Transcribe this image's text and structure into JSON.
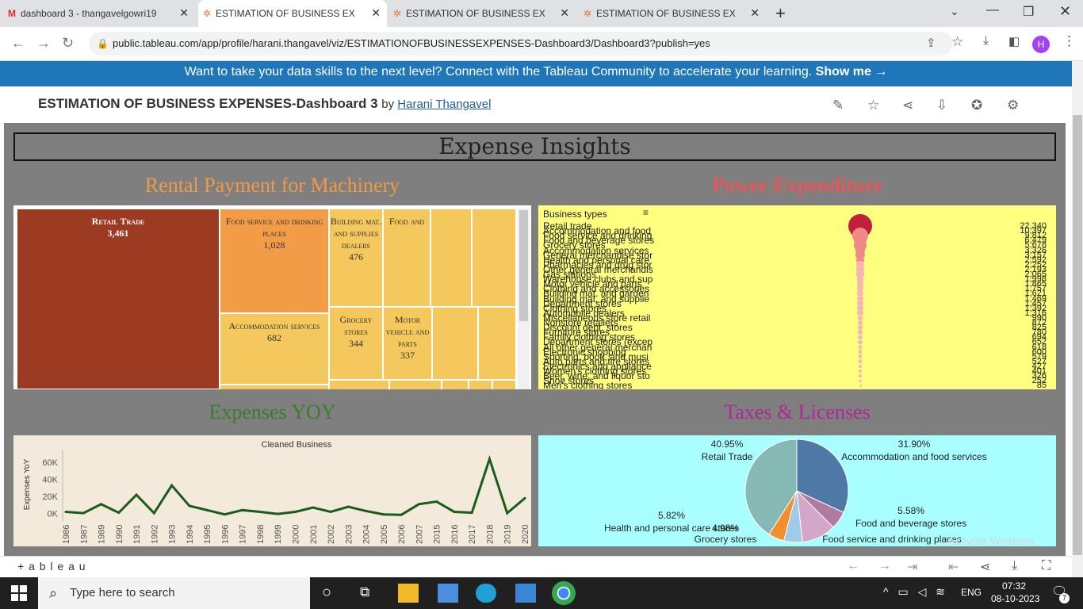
{
  "browser": {
    "tabs": [
      {
        "title": "dashboard 3 - thangavelgowri19",
        "icon": "gmail-icon"
      },
      {
        "title": "ESTIMATION OF BUSINESS EXPE",
        "icon": "tableau-icon",
        "active": true
      },
      {
        "title": "ESTIMATION OF BUSINESS EXPE",
        "icon": "tableau-icon"
      },
      {
        "title": "ESTIMATION OF BUSINESS EXPE",
        "icon": "tableau-icon"
      }
    ],
    "url": "public.tableau.com/app/profile/harani.thangavel/viz/ESTIMATIONOFBUSINESSEXPENSES-Dashboard3/Dashboard3?publish=yes",
    "profile_initial": "H"
  },
  "banner": {
    "text": "Want to take your data skills to the next level? Connect with the Tableau Community to accelerate your learning.",
    "link": "Show me →"
  },
  "viz": {
    "title": "ESTIMATION OF BUSINESS EXPENSES-Dashboard 3",
    "by": "by",
    "author": "Harani Thangavel"
  },
  "dashboard": {
    "header": "Expense Insights",
    "rental_title": "Rental Payment for Machinery",
    "power_title": "Power  Expenditure",
    "yoy_title": "Expenses YOY",
    "tax_title": "Taxes & Licenses",
    "colors": {
      "rental": "#f19a45",
      "power": "#e05a5a",
      "yoy": "#3a7d2c",
      "tax": "#b0269a"
    }
  },
  "treemap": {
    "cells": [
      {
        "name": "Retail Trade",
        "value": "3,461",
        "color": "#9d3a22",
        "text": "#fff"
      },
      {
        "name": "Food service and drinking places",
        "value": "1,028",
        "color": "#f39c47"
      },
      {
        "name": "Building mat. and supplies dealers",
        "value": "476",
        "color": "#f4c85c"
      },
      {
        "name": "Food and",
        "value": "",
        "color": "#f4c85c"
      },
      {
        "name": "Accommodation services",
        "value": "682",
        "color": "#f4c85c"
      },
      {
        "name": "Grocery stores",
        "value": "344",
        "color": "#f4c85c"
      },
      {
        "name": "Motor vehicle and parts",
        "value": "337",
        "color": "#f4c85c"
      }
    ]
  },
  "power": {
    "header": "Business types",
    "rows": [
      {
        "name": "Retail trade",
        "value": "22,340"
      },
      {
        "name": "Accommodation and food",
        "value": "10,397"
      },
      {
        "name": "Food service and drinking",
        "value": "9,812"
      },
      {
        "name": "Food and beverage stores",
        "value": "6,479"
      },
      {
        "name": "Grocery stores",
        "value": "5,678"
      },
      {
        "name": "Accommodation services",
        "value": "3,326"
      },
      {
        "name": "General merchandise stor",
        "value": "3,157"
      },
      {
        "name": "Health and personal care",
        "value": "2,592"
      },
      {
        "name": "Pharmacies and drug stor",
        "value": "2,252"
      },
      {
        "name": "Other general merchandis",
        "value": "2,193"
      },
      {
        "name": "Gas stations",
        "value": "2,065"
      },
      {
        "name": "Warehouse clubs and sup",
        "value": "1,998"
      },
      {
        "name": "Motor vehicle and parts",
        "value": "1,865"
      },
      {
        "name": "Clothing and accessories",
        "value": "1,757"
      },
      {
        "name": "Building mat. and garden",
        "value": "1,621"
      },
      {
        "name": "Building mat. and supplie",
        "value": "1,469"
      },
      {
        "name": "Department stores",
        "value": "1,457"
      },
      {
        "name": "Clothing stores",
        "value": "1,392"
      },
      {
        "name": "Automobile dealers",
        "value": "1,316"
      },
      {
        "name": "Miscellaneous store retail",
        "value": "990"
      },
      {
        "name": "Nonstore retailers",
        "value": "872"
      },
      {
        "name": "Discount dept. stores",
        "value": "825"
      },
      {
        "name": "Furniture stores",
        "value": "780"
      },
      {
        "name": "Family clothing stores",
        "value": "694"
      },
      {
        "name": "Department stores (excep",
        "value": "652"
      },
      {
        "name": "All other general merchan",
        "value": "618"
      },
      {
        "name": "Electronic shopping",
        "value": "600"
      },
      {
        "name": "Sporting, book, and musi",
        "value": "579"
      },
      {
        "name": "Auto parts and tire stores",
        "value": "527"
      },
      {
        "name": "Electronics and appliance",
        "value": "427"
      },
      {
        "name": "Women's clothing stores",
        "value": "401"
      },
      {
        "name": "Beer, wine, and liquor sto",
        "value": "326"
      },
      {
        "name": "Shoe stores",
        "value": "252"
      },
      {
        "name": "Men's clothing stores",
        "value": "85"
      }
    ]
  },
  "chart_data": [
    {
      "type": "line",
      "title": "Cleaned Business",
      "ylabel": "Expenses YoY",
      "xlabel": "",
      "yticks": [
        "60K",
        "40K",
        "20K",
        "0K"
      ],
      "ylim": [
        -5000,
        75000
      ],
      "x": [
        "1986",
        "1987",
        "1989",
        "1990",
        "1991",
        "1992",
        "1993",
        "1994",
        "1995",
        "1996",
        "1997",
        "1998",
        "1999",
        "2000",
        "2001",
        "2002",
        "2003",
        "2004",
        "2005",
        "2006",
        "2007",
        "2015",
        "2016",
        "2017",
        "2018",
        "2019",
        "2020"
      ],
      "values": [
        2000,
        500,
        11000,
        1000,
        22000,
        500,
        33000,
        9000,
        4000,
        -1000,
        4000,
        2000,
        -500,
        2000,
        7000,
        2000,
        8000,
        3000,
        -1000,
        -1500,
        11000,
        14000,
        2000,
        1000,
        64000,
        500,
        18000
      ],
      "color": "#1a5c1a"
    },
    {
      "type": "pie",
      "slices": [
        {
          "label": "Retail Trade",
          "value": 40.95,
          "color": "#86b8b4"
        },
        {
          "label": "Accommodation and food services",
          "value": 31.9,
          "color": "#4e79a7"
        },
        {
          "label": "Food and beverage stores",
          "value": 5.58,
          "color": "#b07aa1"
        },
        {
          "label": "Food service and drinking places",
          "value": 10.77,
          "color": "#d4a6c8"
        },
        {
          "label": "Health and personal care stores",
          "value": 5.82,
          "color": "#a0cbe8"
        },
        {
          "label": "Grocery stores",
          "value": 4.98,
          "color": "#f28e2b"
        }
      ],
      "percent_labels": [
        "40.95%",
        "31.90%",
        "5.58%",
        "5.82%",
        "4.98%"
      ]
    }
  ],
  "footer": {
    "brand": "+ a b l e a u"
  },
  "watermark": "Activate Windows",
  "taskbar": {
    "search_placeholder": "Type here to search",
    "language": "ENG",
    "time": "07:32",
    "date": "08-10-2023",
    "notifications": "7"
  }
}
